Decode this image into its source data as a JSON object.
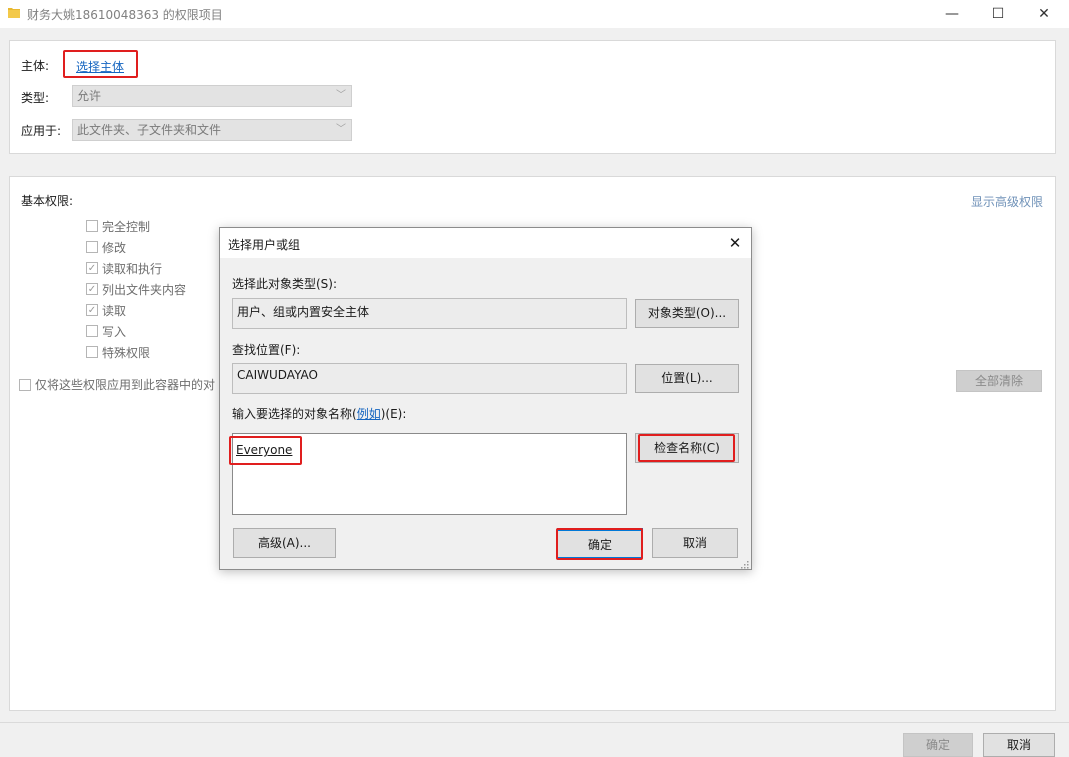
{
  "window": {
    "title": "财务大姚18610048363 的权限项目",
    "minimize_glyph": "—",
    "maximize_glyph": "☐",
    "close_glyph": "✕"
  },
  "top_panel": {
    "principal_label": "主体:",
    "principal_link": "选择主体",
    "type_label": "类型:",
    "type_value": "允许",
    "applies_label": "应用于:",
    "applies_value": "此文件夹、子文件夹和文件"
  },
  "permissions": {
    "basic_label": "基本权限:",
    "show_advanced": "显示高级权限",
    "items": [
      {
        "label": "完全控制",
        "checked": false
      },
      {
        "label": "修改",
        "checked": false
      },
      {
        "label": "读取和执行",
        "checked": true
      },
      {
        "label": "列出文件夹内容",
        "checked": true
      },
      {
        "label": "读取",
        "checked": true
      },
      {
        "label": "写入",
        "checked": false
      },
      {
        "label": "特殊权限",
        "checked": false
      }
    ],
    "only_apply_label": "仅将这些权限应用到此容器中的对",
    "clear_all": "全部清除"
  },
  "footer": {
    "ok": "确定",
    "cancel": "取消"
  },
  "dialog": {
    "title": "选择用户或组",
    "close_glyph": "✕",
    "object_type_label": "选择此对象类型(S):",
    "object_type_value": "用户、组或内置安全主体",
    "object_type_button": "对象类型(O)...",
    "location_label": "查找位置(F):",
    "location_value": "CAIWUDAYAO",
    "location_button": "位置(L)...",
    "enter_names_prefix": "输入要选择的对象名称(",
    "examples_link": "例如",
    "enter_names_suffix": ")(E):",
    "names_value": "Everyone",
    "check_names_button": "检查名称(C)",
    "advanced_button": "高级(A)...",
    "ok_button": "确定",
    "cancel_button": "取消"
  },
  "colors": {
    "highlight_red": "#e01e1e",
    "link_blue": "#1565c0",
    "focus_blue": "#0078d7"
  }
}
